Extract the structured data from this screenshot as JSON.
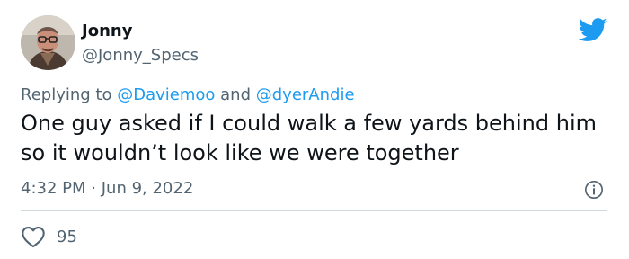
{
  "author": {
    "name": "Jonny",
    "handle": "@Jonny_Specs"
  },
  "reply": {
    "prefix": "Replying to",
    "mention_1": "@Daviemoo",
    "joiner": "and",
    "mention_2": "@dyerAndie"
  },
  "tweet": {
    "text": "One guy asked if I could walk a few yards behind him so it wouldn’t look like we were together"
  },
  "meta": {
    "time": "4:32 PM",
    "separator": "·",
    "date": "Jun 9, 2022"
  },
  "engagement": {
    "likes": "95"
  },
  "icons": {
    "brand": "twitter-bird-icon",
    "info": "info-icon",
    "like": "heart-icon"
  },
  "colors": {
    "brand_blue": "#1d9bf0",
    "secondary_text": "#536471",
    "primary_text": "#0f1419",
    "divider": "#cfd9de"
  }
}
